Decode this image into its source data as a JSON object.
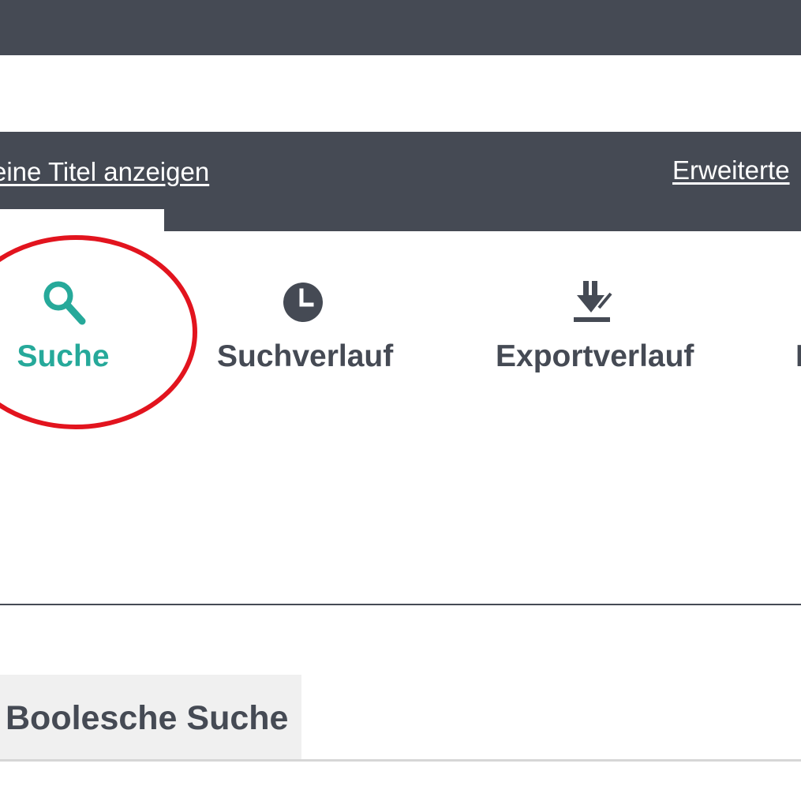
{
  "header": {
    "background_color": "#454a54"
  },
  "search_bar": {
    "background_color": "#454a54",
    "show_titles_link": "eine Titel anzeigen",
    "advanced_link": "Erweiterte"
  },
  "nav": {
    "active_color": "#26a99a",
    "inactive_color": "#454a54",
    "items": [
      {
        "label": "Suche",
        "icon": "search-icon",
        "active": true
      },
      {
        "label": "Suchverlauf",
        "icon": "clock-icon",
        "active": false
      },
      {
        "label": "Exportverlauf",
        "icon": "download-icon",
        "active": false
      },
      {
        "label": "I",
        "icon": "",
        "active": false
      }
    ]
  },
  "annotation": {
    "ring_color": "#e2141e"
  },
  "search_tabs": {
    "items": [
      {
        "label": "Boolesche Suche",
        "active": false
      }
    ]
  }
}
